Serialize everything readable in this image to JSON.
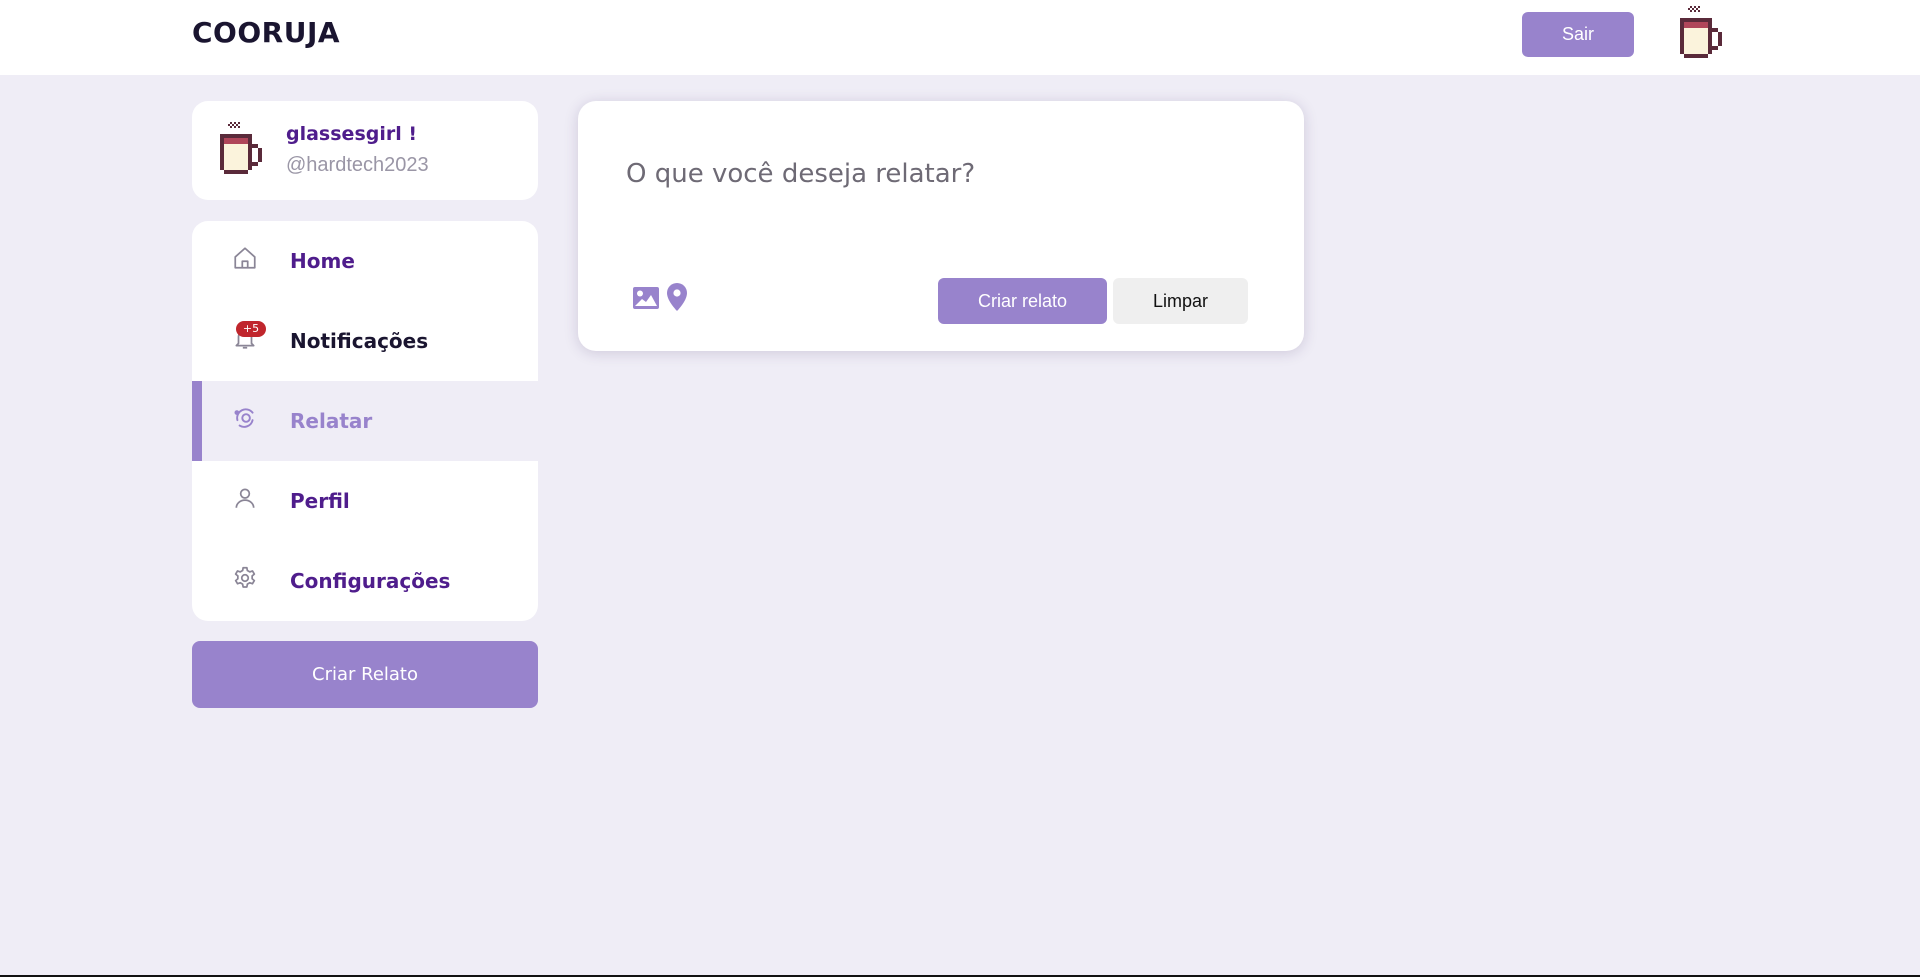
{
  "header": {
    "brand": "COORUJA",
    "logout_label": "Sair",
    "avatar_icon": "coffee-mug-icon"
  },
  "profile": {
    "name": "glassesgirl !",
    "handle": "@hardtech2023",
    "avatar_icon": "coffee-mug-icon"
  },
  "nav": {
    "items": [
      {
        "label": "Home",
        "icon": "home-icon"
      },
      {
        "label": "Notificações",
        "icon": "bell-icon",
        "badge": "+5"
      },
      {
        "label": "Relatar",
        "icon": "report-icon",
        "active": true
      },
      {
        "label": "Perfil",
        "icon": "user-icon"
      },
      {
        "label": "Configurações",
        "icon": "gear-icon"
      }
    ]
  },
  "sidebar": {
    "create_report_label": "Criar Relato"
  },
  "composer": {
    "placeholder": "O que você deseja relatar?",
    "submit_label": "Criar relato",
    "clear_label": "Limpar",
    "tools": [
      "image-icon",
      "location-pin-icon"
    ]
  },
  "colors": {
    "accent": "#9883cc",
    "nav_label": "#4f1d8c",
    "background": "#efedf6",
    "badge": "#c0262d"
  }
}
